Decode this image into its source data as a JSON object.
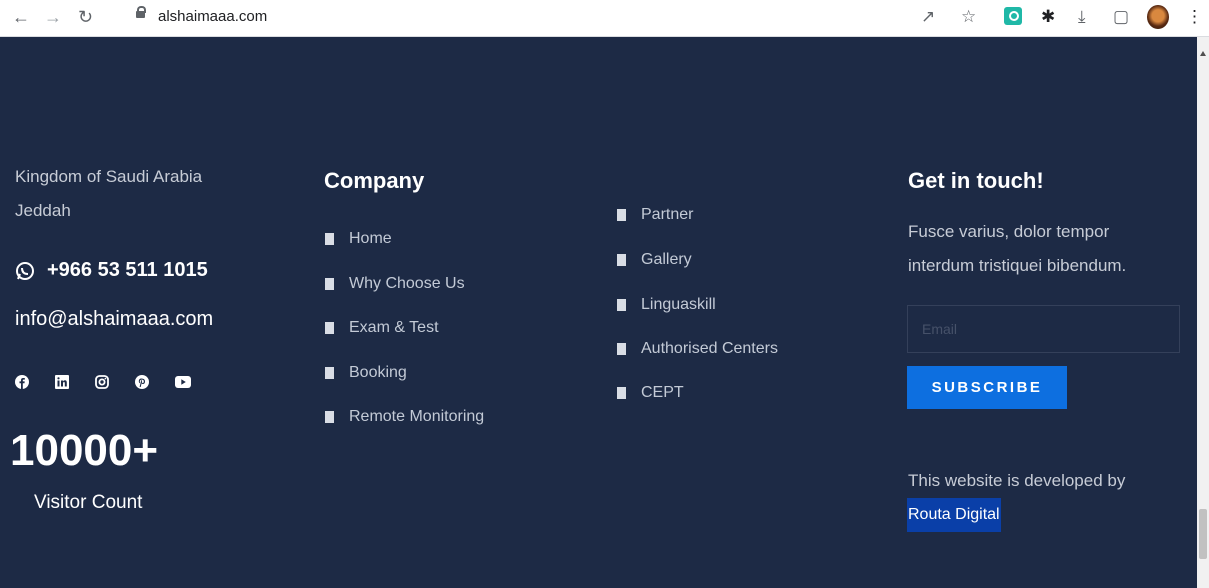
{
  "browser": {
    "url": "alshaimaaa.com"
  },
  "contact": {
    "country": "Kingdom of Saudi Arabia",
    "city": "Jeddah",
    "phone": "+966 53 511 1015",
    "email": "info@alshaimaaa.com",
    "social_icons": [
      "facebook-icon",
      "linkedin-icon",
      "instagram-icon",
      "pinterest-icon",
      "youtube-icon"
    ]
  },
  "visitors": {
    "count": "10000+",
    "label": "Visitor Count"
  },
  "company": {
    "heading": "Company",
    "links": [
      "Home",
      "Why Choose Us",
      "Exam & Test",
      "Booking",
      "Remote Monitoring"
    ]
  },
  "more_links": [
    "Partner",
    "Gallery",
    "Linguaskill",
    "Authorised Centers",
    "CEPT"
  ],
  "newsletter": {
    "heading": "Get in touch!",
    "text_line1": "Fusce varius, dolor tempor",
    "text_line2": "interdum tristiquei bibendum.",
    "email_placeholder": "Email",
    "button_label": "SUBSCRIBE"
  },
  "credit": {
    "text": "This website is developed by",
    "link": "Routa Digital"
  },
  "colors": {
    "background": "#1d2a45",
    "accent": "#0d6fe0",
    "credit_highlight": "#0a3fa8"
  }
}
